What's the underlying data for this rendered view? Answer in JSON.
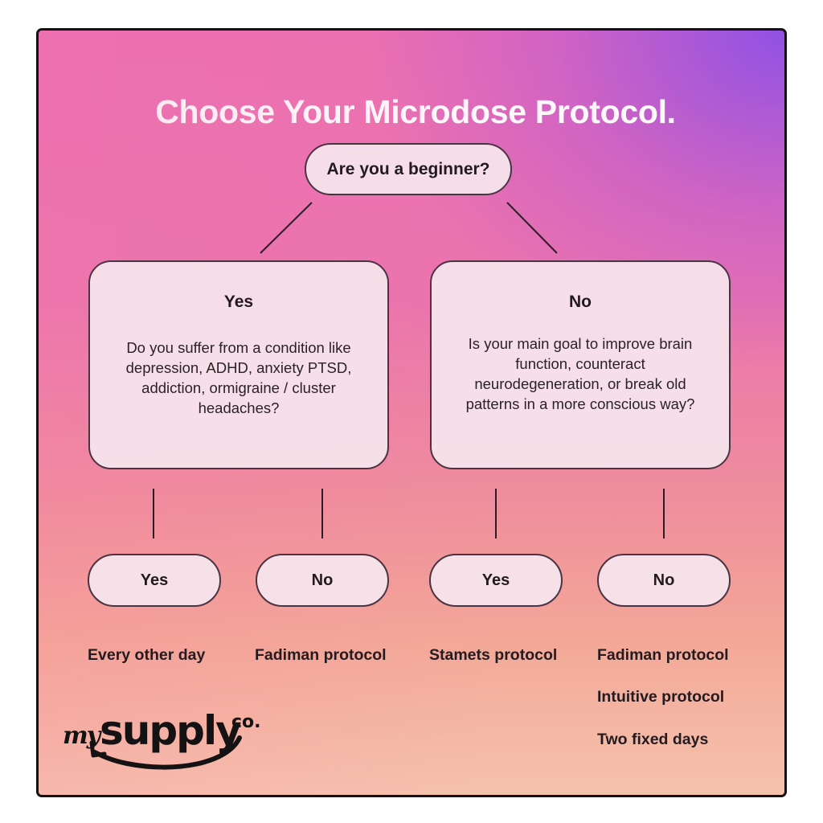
{
  "title": "Choose Your Microdose Protocol.",
  "root_question": "Are you a beginner?",
  "branches": [
    {
      "answer": "Yes",
      "question": "Do you suffer from a condition like depression, ADHD, anxiety PTSD, addiction, ormigraine / cluster headaches?",
      "outcomes": [
        {
          "answer": "Yes",
          "results": [
            "Every other day"
          ]
        },
        {
          "answer": "No",
          "results": [
            "Fadiman protocol"
          ]
        }
      ]
    },
    {
      "answer": "No",
      "question": "Is your main goal to improve brain function, counteract neurodegeneration, or break old patterns in a more conscious way?",
      "outcomes": [
        {
          "answer": "Yes",
          "results": [
            "Stamets protocol"
          ]
        },
        {
          "answer": "No",
          "results": [
            "Fadiman protocol",
            "Intuitive protocol",
            "Two fixed days"
          ]
        }
      ]
    }
  ],
  "logo": {
    "prefix": "my",
    "main": "supply",
    "suffix": "co."
  },
  "colors": {
    "gradient_top_left": "#ea6fb1",
    "gradient_top_right": "#8c50e6",
    "gradient_bottom": "#f5c2ad",
    "node_fill": "#f6e6ee",
    "node_border": "#4b3343",
    "text_dark": "#221a1f",
    "title_text": "#fff8fb"
  }
}
